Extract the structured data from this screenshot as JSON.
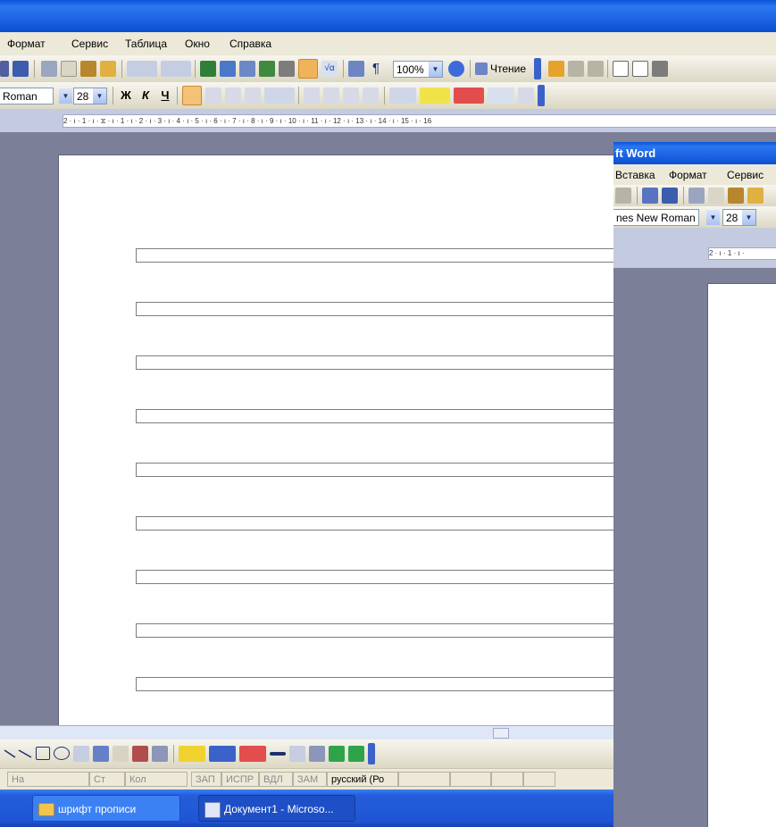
{
  "main_window": {
    "menu": [
      "Формат",
      "Сервис",
      "Таблица",
      "Окно",
      "Справка"
    ],
    "toolbar": {
      "zoom": "100%",
      "reading_button": "Чтение"
    },
    "format_toolbar": {
      "font_name": "Roman",
      "font_size": "28",
      "bold_glyph": "Ж",
      "italic_glyph": "К",
      "underline_glyph": "Ч"
    },
    "ruler_text": "2 · ı · 1 · ı · ⧖ · ı · 1 · ı · 2 · ı · 3 · ı · 4 · ı · 5 · ı · 6 · ı · 7 · ı · 8 · ı · 9 · ı · 10 · ı · 11 · ı · 12 · ı · 13 · ı · 14 · ı · 15 · ı · 16",
    "document": {
      "line_count": 9
    },
    "statusbar": {
      "cells": [
        "На",
        "Ст",
        "Кол",
        "ЗАП",
        "ИСПР",
        "ВДЛ",
        "ЗАМ",
        "русский (Ро"
      ]
    }
  },
  "taskbar": {
    "items": [
      {
        "label": "шрифт прописи",
        "icon": "folder-icon"
      },
      {
        "label": "Документ1 - Microso...",
        "icon": "word-doc-icon"
      }
    ]
  },
  "second_window": {
    "title": "ft Word",
    "menu": [
      "Вставка",
      "Формат",
      "Сервис"
    ],
    "font_name": "nes New Roman",
    "font_size": "28",
    "ruler_text": "2 · ı · 1 · ı ·"
  },
  "colors": {
    "titlebar": "#0a53d8",
    "workspace": "#7b7f98",
    "menubar": "#ece9d8",
    "taskbar": "#245edb"
  }
}
